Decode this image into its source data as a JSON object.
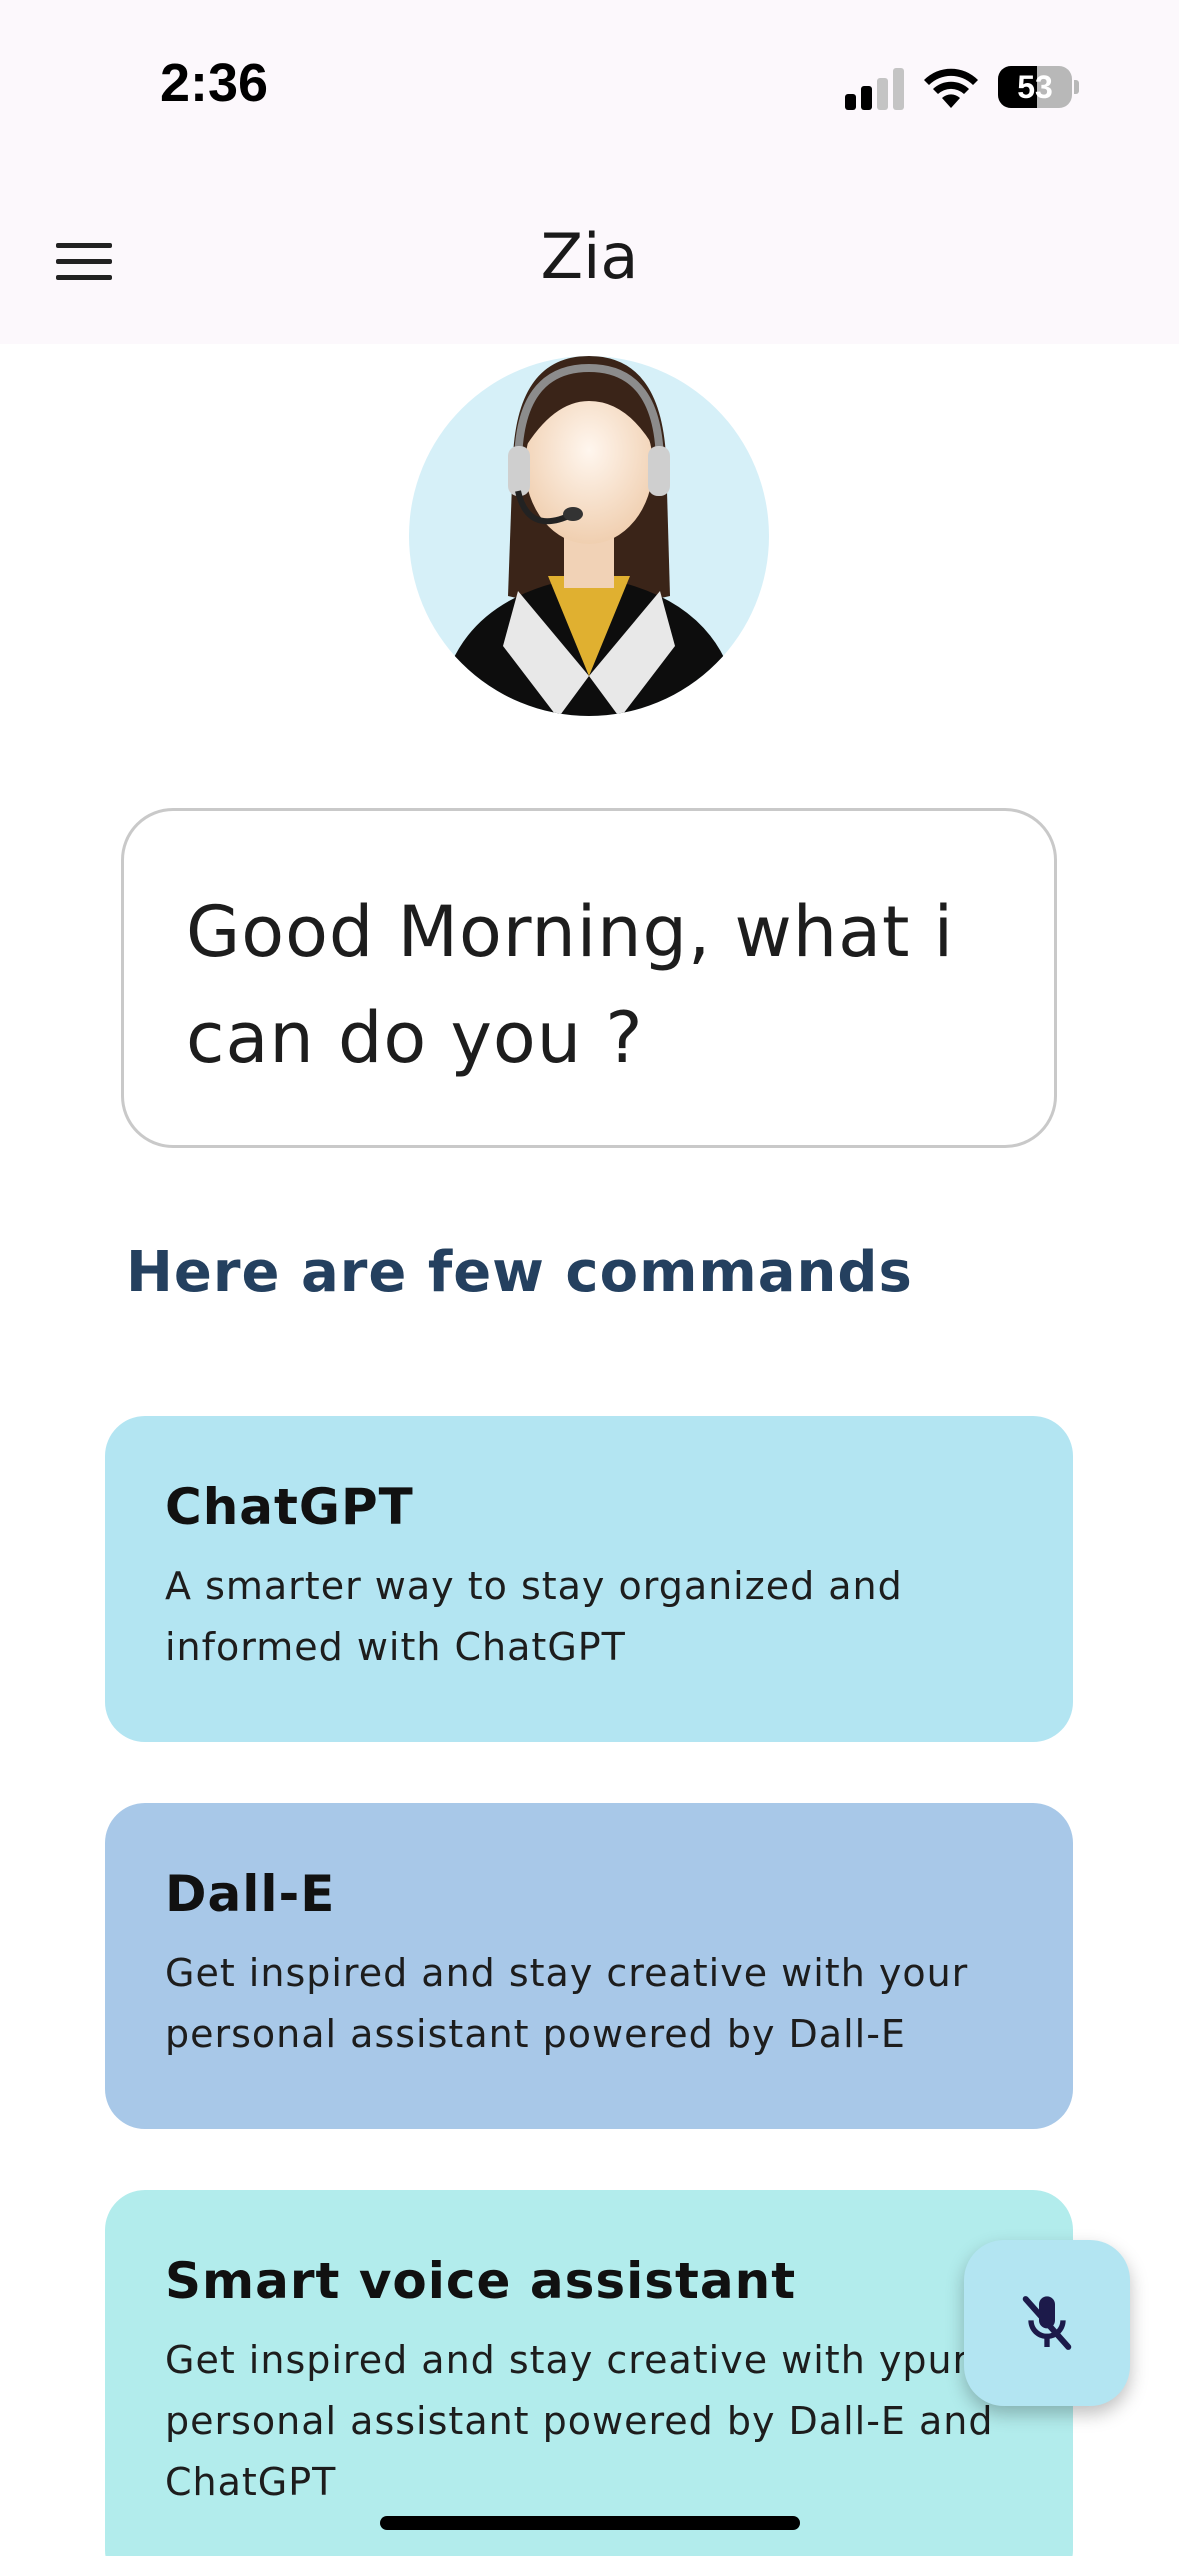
{
  "status_bar": {
    "time": "2:36",
    "battery_level": "53",
    "battery_fraction": 0.53
  },
  "app_bar": {
    "title": "Zia",
    "menu_icon": "hamburger-menu-icon"
  },
  "avatar": {
    "icon": "support-agent-avatar"
  },
  "greeting": {
    "text": "Good Morning, what i can do you ?"
  },
  "commands": {
    "heading": "Here are few commands",
    "items": [
      {
        "title": "ChatGPT",
        "description": "A smarter way to stay organized and informed with ChatGPT",
        "color": "#b3e5f2"
      },
      {
        "title": "Dall-E",
        "description": "Get inspired and stay creative with your personal assistant powered by Dall-E",
        "color": "#a8c8e8"
      },
      {
        "title": "Smart voice assistant",
        "description": "Get inspired and stay creative with ypur personal assistant powered by Dall-E and ChatGPT",
        "color": "#b2ecec"
      }
    ]
  },
  "fab": {
    "icon": "mic-off-icon",
    "color": "#b3e5f2"
  },
  "colors": {
    "accent_heading": "#24405f",
    "app_bar_bg": "#fcf8fc"
  }
}
